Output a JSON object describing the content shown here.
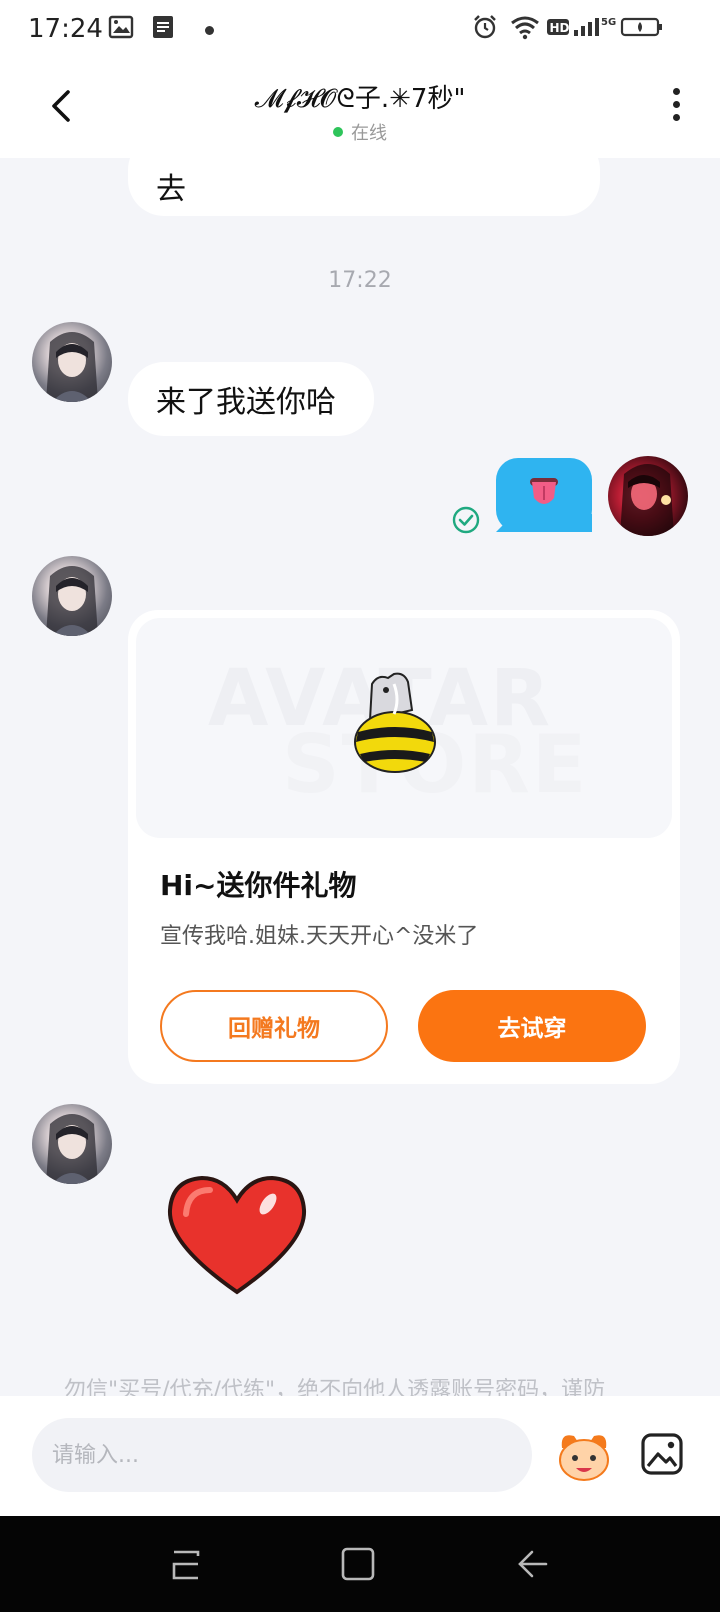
{
  "status_bar": {
    "time": "17:24",
    "network": "5G"
  },
  "header": {
    "title": "𝓜𝓯𝓗𝓞ᘓ子.✳7秒\"",
    "presence": "在线"
  },
  "messages": [
    {
      "side": "left",
      "type": "text",
      "text": "去"
    },
    {
      "type": "timestamp",
      "text": "17:22"
    },
    {
      "side": "left",
      "type": "text",
      "text": "来了我送你哈"
    },
    {
      "side": "right",
      "type": "sticker",
      "sticker": "tongue-sticker",
      "status": "read"
    },
    {
      "side": "left",
      "type": "gift_card"
    },
    {
      "side": "left",
      "type": "sticker",
      "sticker": "heart-sticker"
    }
  ],
  "gift_card": {
    "watermark_line1": "AVATAR",
    "watermark_line2": "STORE",
    "title": "Hi~送你件礼物",
    "description": "宣传我哈.姐妹.天天开心^没米了",
    "return_button": "回赠礼物",
    "try_button": "去试穿"
  },
  "warning_text": "勿信\"买号/代充/代练\"，绝不向他人透露账号密码，谨防",
  "input": {
    "placeholder": "请输入..."
  },
  "colors": {
    "accent_orange": "#fb7411",
    "sticker_blue": "#2fb4f0",
    "online_green": "#2ec45a",
    "chat_background": "#f4f5f9"
  }
}
